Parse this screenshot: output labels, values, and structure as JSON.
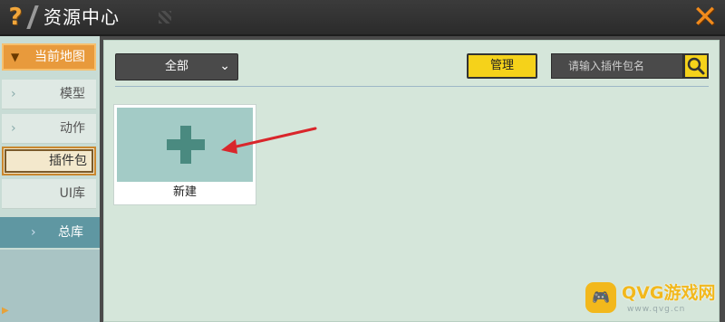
{
  "window": {
    "title": "资源中心"
  },
  "sidebar": {
    "current": "当前地图",
    "items": [
      {
        "label": "模型",
        "selected": false
      },
      {
        "label": "动作",
        "selected": false
      },
      {
        "label": "插件包",
        "selected": true
      },
      {
        "label": "UI库",
        "selected": false
      }
    ],
    "total": "总库"
  },
  "toolbar": {
    "filter_value": "全部",
    "manage_label": "管理",
    "search_placeholder": "请输入插件包名"
  },
  "cards": [
    {
      "label": "新建",
      "icon": "plus-icon"
    }
  ],
  "watermark": {
    "brand": "QVG游戏网",
    "sub": "www.qvg.cn"
  },
  "colors": {
    "accent": "#f5d21a",
    "sidebar_active": "#e89a3c",
    "total_bg": "#5f97a2",
    "arrow": "#d9262b"
  }
}
